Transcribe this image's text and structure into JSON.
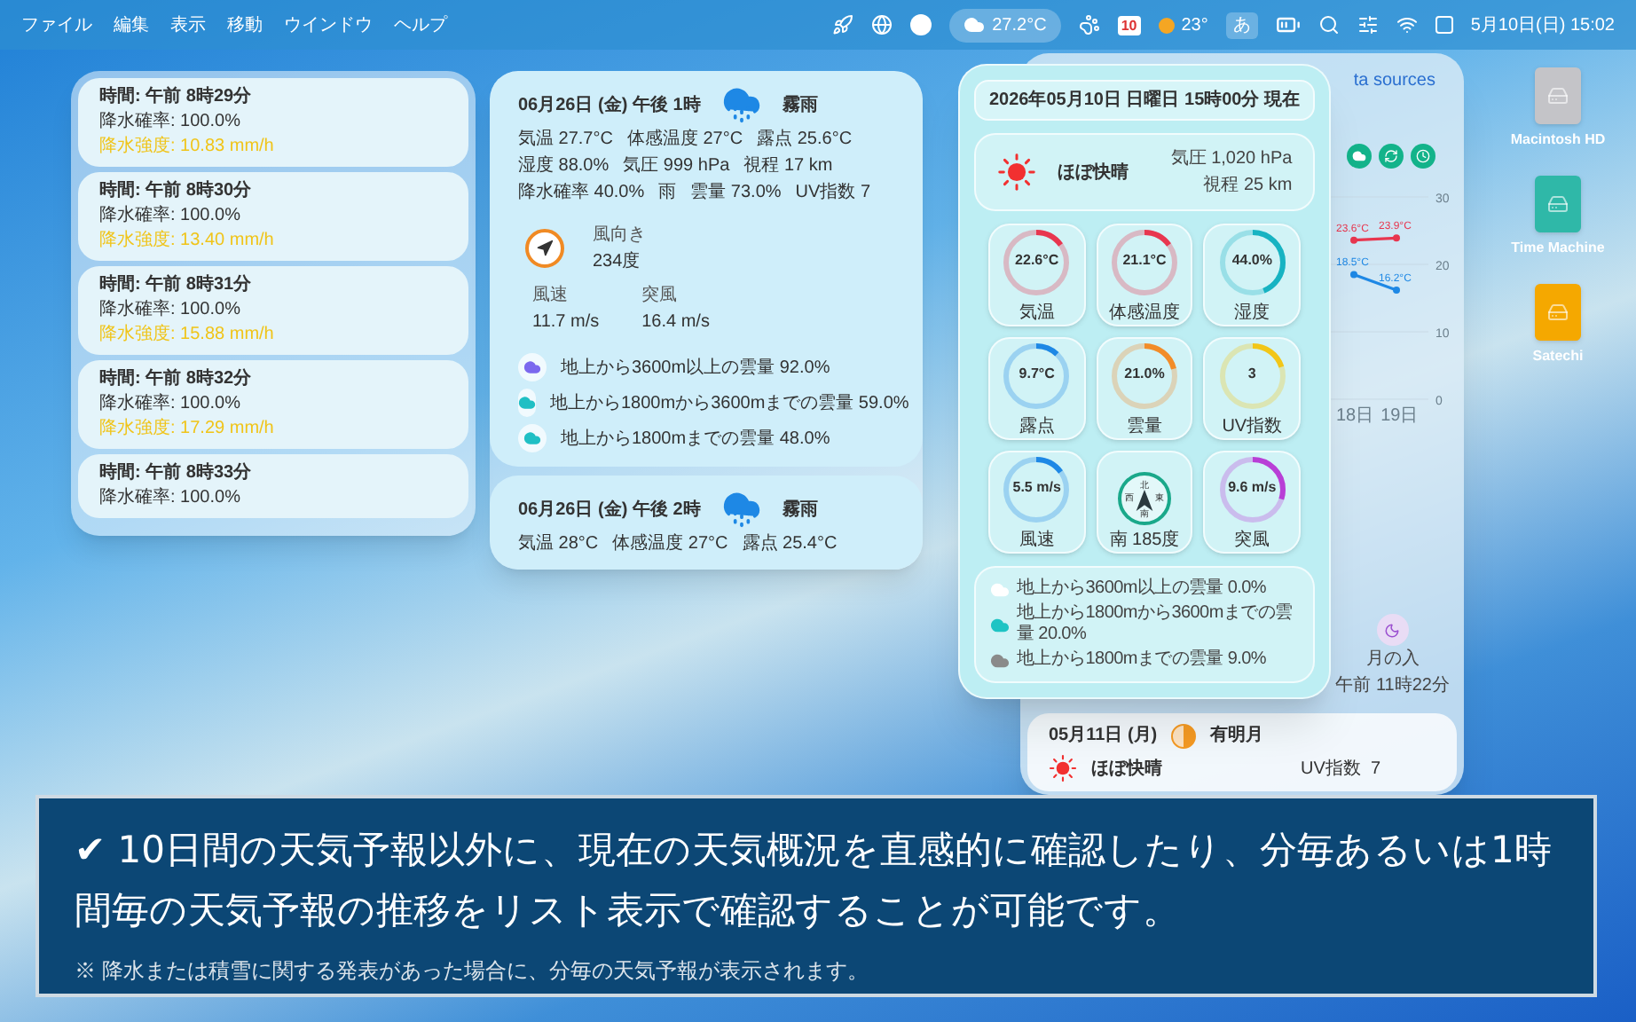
{
  "menu_bar": {
    "menus": [
      "ファイル",
      "編集",
      "表示",
      "移動",
      "ウインドウ",
      "ヘルプ"
    ],
    "weather": "27.2°C",
    "calendar_day": "10",
    "forecast": "23°",
    "input_method": "あ",
    "clock": "5月10日(日) 15:02"
  },
  "minute_forecast": [
    {
      "time": "時間: 午前 8時29分",
      "probability": "降水確率: 100.0%",
      "intensity": "降水強度: 10.83 mm/h"
    },
    {
      "time": "時間: 午前 8時30分",
      "probability": "降水確率: 100.0%",
      "intensity": "降水強度: 13.40 mm/h"
    },
    {
      "time": "時間: 午前 8時31分",
      "probability": "降水確率: 100.0%",
      "intensity": "降水強度: 15.88 mm/h"
    },
    {
      "time": "時間: 午前 8時32分",
      "probability": "降水確率: 100.0%",
      "intensity": "降水強度: 17.29 mm/h"
    },
    {
      "time": "時間: 午前 8時33分",
      "probability": "降水確率: 100.0%"
    }
  ],
  "hourly_forecast": [
    {
      "header": "06月26日 (金) 午後 1時",
      "condition": "霧雨",
      "rows": [
        [
          {
            "label": "気温",
            "value": "27.7°C"
          },
          {
            "label": "体感温度",
            "value": "27°C"
          },
          {
            "label": "露点",
            "value": "25.6°C"
          }
        ],
        [
          {
            "label": "湿度",
            "value": "88.0%"
          },
          {
            "label": "気圧",
            "value": "999 hPa"
          },
          {
            "label": "視程",
            "value": "17 km"
          }
        ],
        [
          {
            "label": "降水確率",
            "value": "40.0%"
          },
          {
            "label": "雨"
          },
          {
            "label": "雲量",
            "value": "73.0%"
          },
          {
            "label": "UV指数",
            "value": "7"
          }
        ]
      ],
      "wind": {
        "direction_label": "風向き",
        "direction": "234度",
        "speed_label": "風速",
        "speed": "11.7 m/s",
        "gust_label": "突風",
        "gust": "16.4 m/s"
      },
      "clouds": [
        {
          "text": "地上から3600m以上の雲量 92.0%",
          "color": "#7b68ee"
        },
        {
          "text": "地上から1800mから3600mまでの雲量 59.0%",
          "color": "#1fbfc4"
        },
        {
          "text": "地上から1800mまでの雲量 48.0%",
          "color": "#1fbfc4"
        }
      ]
    },
    {
      "header": "06月26日 (金) 午後 2時",
      "condition": "霧雨",
      "rows": [
        [
          {
            "label": "気温",
            "value": "28°C"
          },
          {
            "label": "体感温度",
            "value": "27°C"
          },
          {
            "label": "露点",
            "value": "25.4°C"
          }
        ]
      ]
    }
  ],
  "current": {
    "timestamp": "2026年05月10日 日曜日 15時00分 現在",
    "condition": "ほぼ快晴",
    "pressure": "気圧 1,020 hPa",
    "visibility": "視程 25 km",
    "gauges": [
      {
        "kind": "ring",
        "value": "22.6°C",
        "label": "気温",
        "level": 0.15,
        "color": "#e8364f"
      },
      {
        "kind": "ring",
        "value": "21.1°C",
        "label": "体感温度",
        "level": 0.15,
        "color": "#e8364f"
      },
      {
        "kind": "ring",
        "value": "44.0%",
        "label": "湿度",
        "level": 0.44,
        "color": "#17b3c2"
      },
      {
        "kind": "ring",
        "value": "9.7°C",
        "label": "露点",
        "level": 0.12,
        "color": "#1e88e5"
      },
      {
        "kind": "ring",
        "value": "21.0%",
        "label": "雲量",
        "level": 0.21,
        "color": "#f28c28"
      },
      {
        "kind": "ring",
        "value": "3",
        "label": "UV指数",
        "level": 0.2,
        "color": "#f2c618"
      },
      {
        "kind": "ring",
        "value": "5.5 m/s",
        "label": "風速",
        "level": 0.15,
        "color": "#1e88e5"
      },
      {
        "kind": "compass",
        "label": "南 185度",
        "directions": [
          "北",
          "東",
          "南",
          "西"
        ]
      },
      {
        "kind": "ring",
        "value": "9.6 m/s",
        "label": "突風",
        "level": 0.3,
        "color": "#b83fd6"
      }
    ],
    "clouds": [
      {
        "text": "地上から3600m以上の雲量 0.0%",
        "color": "#ffffff"
      },
      {
        "text": "地上から1800mから3600mまでの雲量 20.0%",
        "color": "#1fc4c4"
      },
      {
        "text": "地上から1800mまでの雲量 9.0%",
        "color": "#8a8a8a"
      }
    ]
  },
  "background_panel": {
    "link": "ta sources",
    "chart_data": {
      "type": "line",
      "categories": [
        "18日",
        "19日"
      ],
      "series": [
        {
          "color": "#e8364f",
          "marker": "circle",
          "values": [
            23.6,
            23.9
          ],
          "value_labels": [
            "23.6°C",
            "23.9°C"
          ]
        },
        {
          "color": "#1e88e5",
          "marker": "circle",
          "values": [
            18.5,
            16.2
          ],
          "value_labels": [
            "18.5°C",
            "16.2°C"
          ]
        }
      ],
      "ylim": [
        0,
        30
      ],
      "yticks": [
        0,
        10,
        20,
        30
      ]
    },
    "moonset": {
      "label": "月の入",
      "time": "午前 11時22分"
    },
    "day": {
      "date": "05月11日 (月)",
      "moon": "有明月",
      "condition": "ほぼ快晴",
      "uv": "UV指数  7"
    }
  },
  "desktop_icons": [
    {
      "label": "Macintosh HD",
      "color": "#c4c4c8"
    },
    {
      "label": "Time Machine",
      "color": "#2fb8a8"
    },
    {
      "label": "Satechi",
      "color": "#f5a800"
    }
  ],
  "caption": {
    "text": "✔ 10日間の天気予報以外に、現在の天気概況を直感的に確認したり、分毎あるいは1時間毎の天気予報の推移をリスト表示で確認することが可能です。",
    "note": "※ 降水または積雪に関する発表があった場合に、分毎の天気予報が表示されます。"
  }
}
